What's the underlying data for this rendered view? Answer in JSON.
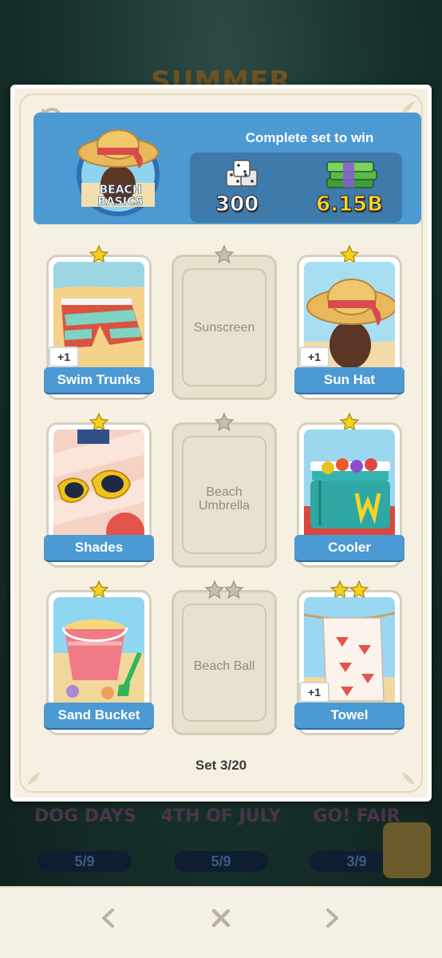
{
  "background": {
    "album_title": "SUMMER",
    "other_sets": [
      {
        "name": "DOG DAYS",
        "progress": "5/9"
      },
      {
        "name": "4TH OF JULY",
        "progress": "5/9"
      },
      {
        "name": "GO! FAIR",
        "progress": "3/9"
      }
    ]
  },
  "header": {
    "set_badge_line1": "BEACH",
    "set_badge_line2": "BASICS",
    "title": "Complete set to win",
    "reward_dice": "300",
    "reward_cash": "6.15B"
  },
  "cards": [
    {
      "name": "Swim Trunks",
      "stars": 1,
      "owned": true,
      "extra": "+1"
    },
    {
      "name": "Sunscreen",
      "stars": 1,
      "owned": false
    },
    {
      "name": "Sun Hat",
      "stars": 1,
      "owned": true,
      "extra": "+1"
    },
    {
      "name": "Shades",
      "stars": 1,
      "owned": true
    },
    {
      "name": "Beach Umbrella",
      "stars": 1,
      "owned": false
    },
    {
      "name": "Cooler",
      "stars": 1,
      "owned": true
    },
    {
      "name": "Sand Bucket",
      "stars": 1,
      "owned": true
    },
    {
      "name": "Beach Ball",
      "stars": 2,
      "owned": false
    },
    {
      "name": "Towel",
      "stars": 2,
      "owned": true,
      "extra": "+1"
    }
  ],
  "set_progress": "Set 3/20",
  "nav": {
    "prev": "<",
    "close": "X",
    "next": ">"
  },
  "colors": {
    "header_blue": "#4d9ad2",
    "label_blue": "#4b9ad4",
    "star_gold": "#f5d21b",
    "star_grey": "#c7bfae",
    "cash_yellow": "#ffd428"
  }
}
